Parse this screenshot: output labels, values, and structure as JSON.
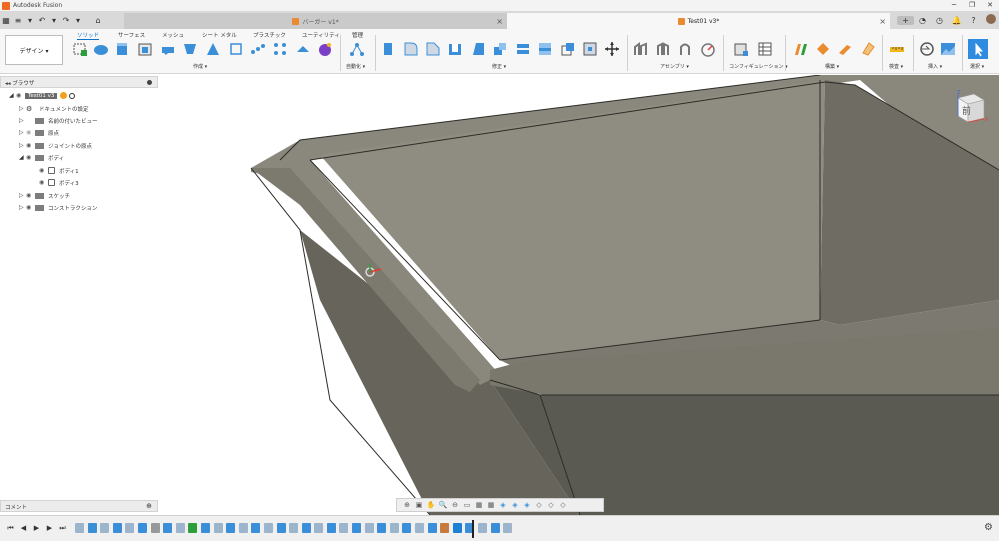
{
  "window": {
    "title": "Autodesk Fusion",
    "controls": [
      "─",
      "❐",
      "✕"
    ]
  },
  "quick_access": [
    "▦",
    "▾",
    "≡",
    "▾",
    "↶",
    "▾",
    "↷",
    "▾"
  ],
  "doc_tabs": [
    {
      "label": "バーガー v1*",
      "active": false
    },
    {
      "label": "Test01 v3*",
      "active": true
    }
  ],
  "right_tab_icons": [
    "+",
    "◔",
    "◷",
    "🔔",
    "?"
  ],
  "workspace": {
    "label": "デザイン ▾"
  },
  "ribbon_tabs": [
    "ソリッド",
    "サーフェス",
    "メッシュ",
    "シート メタル",
    "プラスチック",
    "ユーティリティ",
    "管理"
  ],
  "ribbon_groups": [
    "作成 ▾",
    "自動化 ▾",
    "修正 ▾",
    "アセンブリ ▾",
    "コンフィギュレーション ▾",
    "構築 ▾",
    "検査 ▾",
    "挿入 ▾",
    "選択 ▾"
  ],
  "browser": {
    "header": "ブラウザ",
    "root": "Test01 v3",
    "items": [
      {
        "label": "ドキュメントの設定",
        "icon": "gear"
      },
      {
        "label": "名前の付いたビュー",
        "icon": "folder"
      },
      {
        "label": "原点",
        "icon": "folder"
      },
      {
        "label": "ジョイントの原点",
        "icon": "folder"
      },
      {
        "label": "ボディ",
        "icon": "folder",
        "expanded": true,
        "children": [
          {
            "label": "ボディ1"
          },
          {
            "label": "ボディ3"
          }
        ]
      },
      {
        "label": "スケッチ",
        "icon": "folder"
      },
      {
        "label": "コンストラクション",
        "icon": "folder"
      }
    ]
  },
  "comments": {
    "header": "コメント"
  },
  "viewcube": {
    "face_label": "前",
    "axis_z": "Z",
    "axis_x": "X"
  },
  "nav_tools": [
    "⊕",
    "▣",
    "✋",
    "🔍",
    "⊖",
    "▭",
    "▦",
    "▦",
    "◈",
    "◈",
    "◈",
    "◇",
    "◇",
    "◇"
  ],
  "timeline_controls": [
    "⏮",
    "◀",
    "▶",
    "▶",
    "⏭"
  ],
  "colors": {
    "accent": "#0a70c8",
    "model_light": "#7f7d72",
    "model_mid": "#66645b",
    "model_dark": "#5b5a52",
    "viewport_bg": "#ffffff"
  }
}
